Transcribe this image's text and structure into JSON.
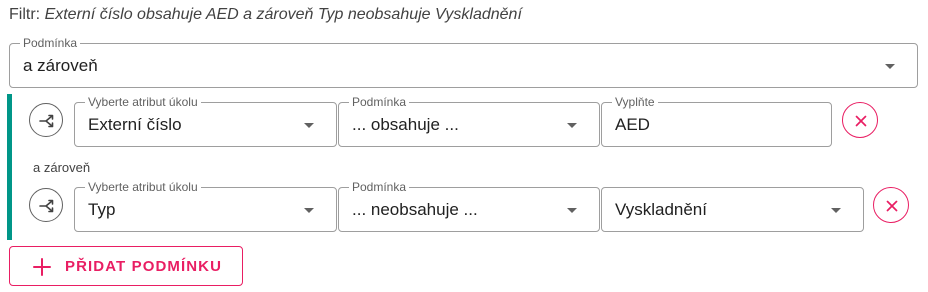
{
  "filter": {
    "prefix": "Filtr:",
    "expression": "Externí číslo obsahuje AED a zároveň Typ neobsahuje Vyskladnění"
  },
  "group_condition": {
    "label": "Podmínka",
    "value": "a zároveň"
  },
  "rows": [
    {
      "attribute": {
        "label": "Vyberte atribut úkolu",
        "value": "Externí číslo"
      },
      "condition": {
        "label": "Podmínka",
        "value": "... obsahuje ..."
      },
      "value_field": {
        "label": "Vyplňte",
        "value": "AED"
      },
      "split_icon": "call-split-icon",
      "remove_icon": "close-icon"
    },
    {
      "attribute": {
        "label": "Vyberte atribut úkolu",
        "value": "Typ"
      },
      "condition": {
        "label": "Podmínka",
        "value": "... neobsahuje ..."
      },
      "value_field": {
        "label": "",
        "value": "Vyskladnění"
      },
      "split_icon": "call-split-icon",
      "remove_icon": "close-icon"
    }
  ],
  "joiner": "a zároveň",
  "add_button": {
    "label": "PŘIDAT PODMÍNKU",
    "icon": "plus-icon"
  },
  "colors": {
    "accent": "#e91e63",
    "group_bar": "#009688",
    "border": "#9e9e9e"
  }
}
